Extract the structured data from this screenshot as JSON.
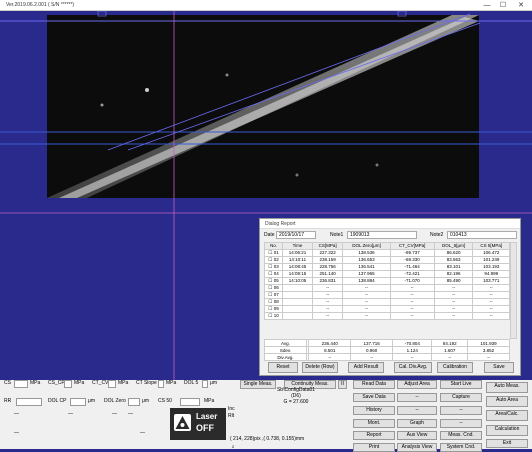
{
  "window": {
    "title": "Ver.2019.06.2.001 ( S/N ******)",
    "minimize": "—",
    "maximize": "☐",
    "close": "✕"
  },
  "report": {
    "title": "Dialog Report",
    "date_label": "Date",
    "date_value": "2019/10/17",
    "note1_label": "Note1",
    "note1_value": "1909013",
    "note2_label": "Note2",
    "note2_value": "010413",
    "columns": [
      "No.",
      "Time",
      "CS[MPa]",
      "DOL Zero[μm]",
      "CT_CV[MPa]",
      "DOL_5[μm]",
      "CS 5[MPa]"
    ],
    "rows": [
      {
        "no": "01",
        "time": "14:06:21",
        "cs": "227.322",
        "dolzero": "138.536",
        "ctcv": "-69.737",
        "dol5": "86.620",
        "cs5": "106.472"
      },
      {
        "no": "02",
        "time": "14:10:11",
        "cs": "238.159",
        "dolzero": "136.653",
        "ctcv": "-69.330",
        "dol5": "83.563",
        "cs5": "101.249"
      },
      {
        "no": "03",
        "time": "14:08:45",
        "cs": "228.756",
        "dolzero": "136.541",
        "ctcv": "-71.464",
        "dol5": "83.101",
        "cs5": "103.193"
      },
      {
        "no": "04",
        "time": "14:09:15",
        "cs": "251.140",
        "dolzero": "137.965",
        "ctcv": "-72.421",
        "dol5": "82.196",
        "cs5": "94.999"
      },
      {
        "no": "05",
        "time": "14:10:05",
        "cs": "236.831",
        "dolzero": "138.884",
        "ctcv": "-71.070",
        "dol5": "85.490",
        "cs5": "103.771"
      },
      {
        "no": "06",
        "time": "",
        "cs": "--",
        "dolzero": "--",
        "ctcv": "--",
        "dol5": "--",
        "cs5": "--"
      },
      {
        "no": "07",
        "time": "",
        "cs": "--",
        "dolzero": "--",
        "ctcv": "--",
        "dol5": "--",
        "cs5": "--"
      },
      {
        "no": "08",
        "time": "",
        "cs": "--",
        "dolzero": "--",
        "ctcv": "--",
        "dol5": "--",
        "cs5": "--"
      },
      {
        "no": "09",
        "time": "",
        "cs": "--",
        "dolzero": "--",
        "ctcv": "--",
        "dol5": "--",
        "cs5": "--"
      },
      {
        "no": "10",
        "time": "",
        "cs": "--",
        "dolzero": "--",
        "ctcv": "--",
        "dol5": "--",
        "cs5": "--"
      }
    ],
    "stats": [
      {
        "label": "Avg.",
        "cs": "236.440",
        "dolzero": "137.716",
        "ctcv": "-70.804",
        "dol5": "84.192",
        "cs5": "101.939"
      },
      {
        "label": "Sdev.",
        "cs": "8.501",
        "dolzero": "0.960",
        "ctcv": "1.124",
        "dol5": "1.607",
        "cs5": "3.852"
      },
      {
        "label": "Div.Avg.",
        "cs": "--",
        "dolzero": "--",
        "ctcv": "--",
        "dol5": "--",
        "cs5": "--"
      }
    ],
    "buttons": [
      "Reset",
      "Delete (Row)",
      "Add Result",
      "Cal. Div.Avg.",
      "Calibration",
      "Save"
    ]
  },
  "panel": {
    "fields_row1": [
      "CS",
      "CS_CP",
      "CT_CV",
      "CT Slope",
      "DOL 5"
    ],
    "units_row1": [
      "MPa",
      "MPa",
      "MPa",
      "MPa",
      "μm"
    ],
    "fields_row2": [
      "RR",
      "DOL CP",
      "DOL Zero",
      "CS 50"
    ],
    "units_row2": [
      "",
      "μm",
      "μm",
      "MPa"
    ],
    "left_dashes": [
      "—",
      "—",
      "—",
      "—",
      "—",
      "—"
    ],
    "single_meas": "Single Meas.",
    "continuity_meas": "Continuity Meas.",
    "pause": "II",
    "info_line1": "Sb\\ConfigData01",
    "info_line2": "(D6)",
    "info_line3": "G = 27.600",
    "inc_label": "Inc",
    "rlt_label": "Rlt",
    "laser_line1": "Laser",
    "laser_line2": "OFF",
    "coords": "( 214, 228)pix ,( 0.738, 0.155)mm",
    "coords_num": "2",
    "col3": [
      "Read Data",
      "Save Data",
      "History",
      "Mont.",
      "Report",
      "Print"
    ],
    "col4": [
      "Adjust Area",
      "--",
      "--",
      "Graph",
      "Aux View",
      "Analysis View"
    ],
    "col5": [
      "Start Live",
      "Capture",
      "--",
      "--",
      "Meas. Cnd.",
      "System Cnd."
    ],
    "col6": [
      "Auto Meas.",
      "Auto Area",
      "Area/Calc.",
      "Calculation",
      "Exit"
    ]
  }
}
